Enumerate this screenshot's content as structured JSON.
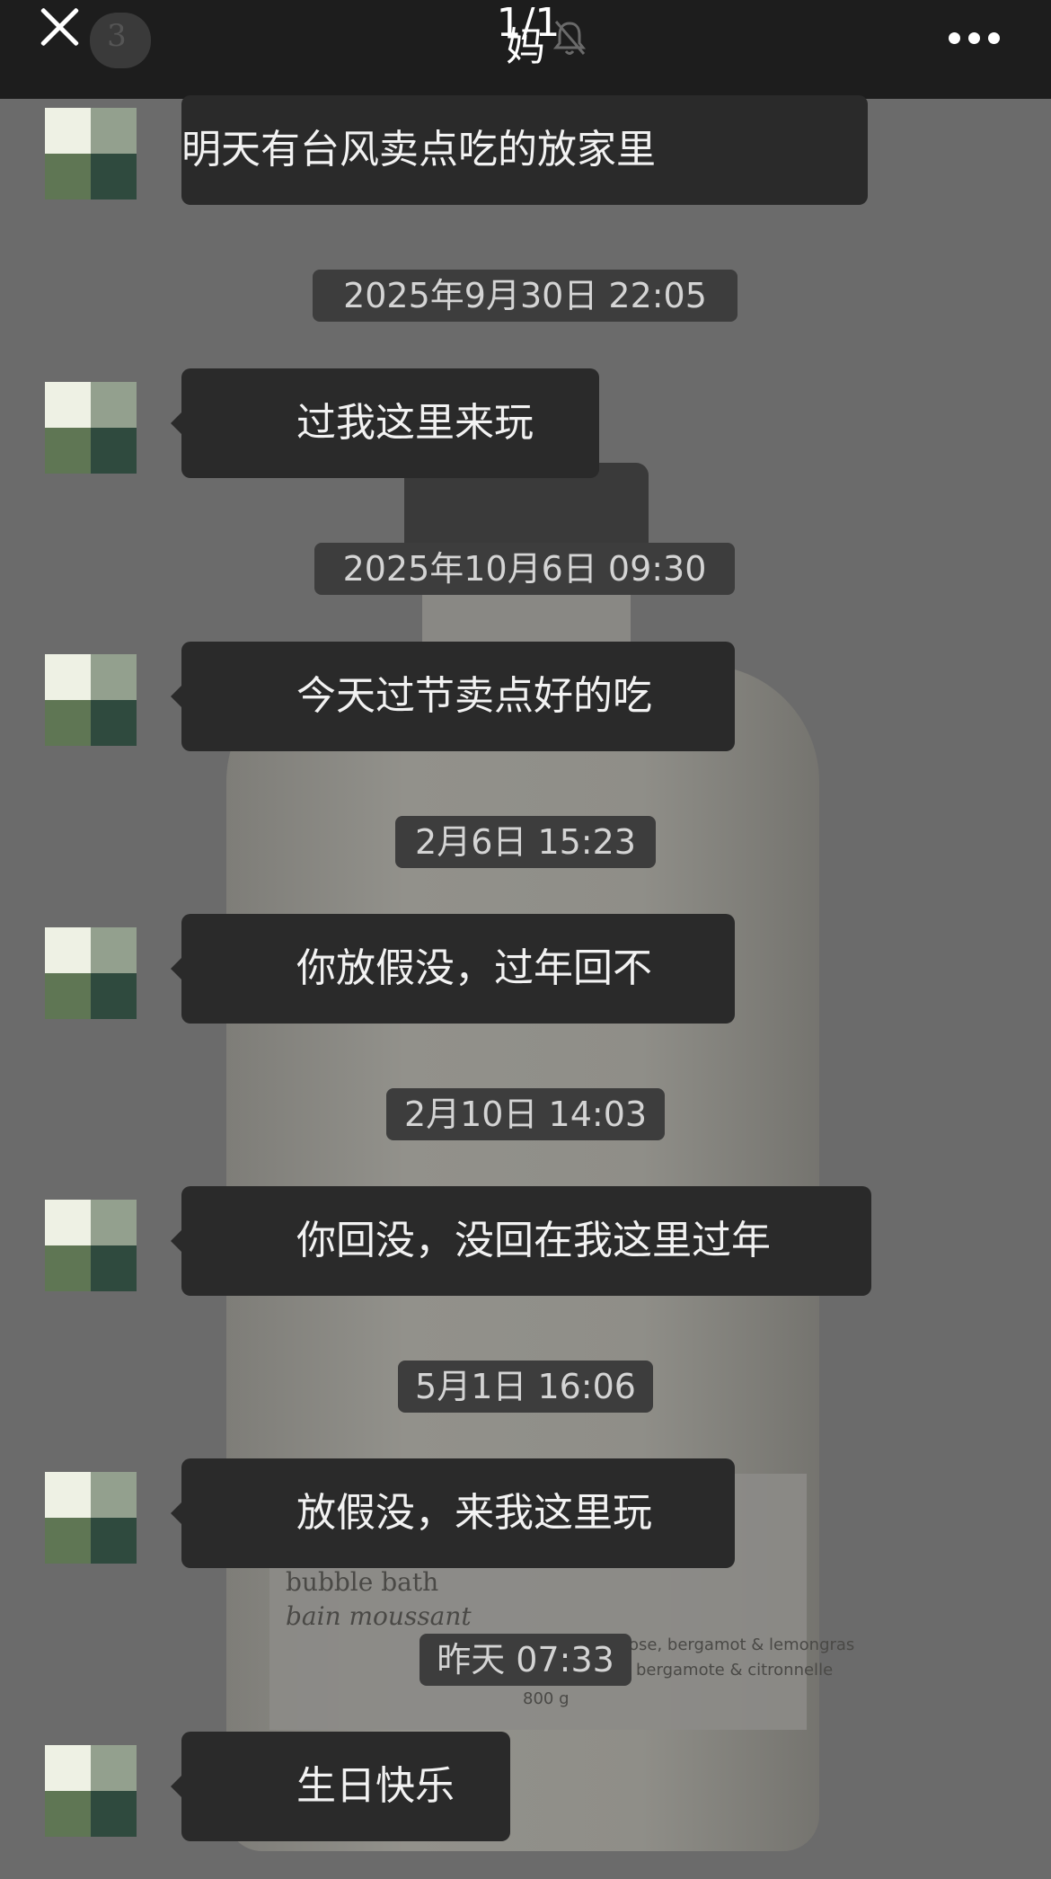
{
  "header": {
    "title": "妈",
    "page_indicator": "1/1",
    "badge_count": "3"
  },
  "messages": [
    {
      "text": "明天有台风卖点吃的放家里"
    },
    {
      "text": "过我这里来玩"
    },
    {
      "text": "今天过节卖点好的吃"
    },
    {
      "text": "你放假没，过年回不"
    },
    {
      "text": "你回没，没回在我这里过年"
    },
    {
      "text": "放假没，来我这里玩"
    },
    {
      "text": "生日快乐"
    }
  ],
  "timestamps": [
    "2025年9月30日 22:05",
    "2025年10月6日 09:30",
    "2月6日 15:23",
    "2月10日 14:03",
    "5月1日 16:06",
    "昨天 07:33"
  ],
  "background_label": {
    "line1": "bubble bath",
    "line2": "bain moussant",
    "line3": "ose, bergamot & lemongras",
    "line4": "bergamote & citronnelle",
    "weight": "800 g"
  },
  "colors": {
    "background": "#6b6b6b",
    "topbar": "#1d1d1d",
    "bubble": "#2a2a2a",
    "timestamp_pill": "#3d3d3d"
  },
  "icons": [
    "close-icon",
    "mute-bell-icon",
    "more-options-icon",
    "avatar"
  ]
}
